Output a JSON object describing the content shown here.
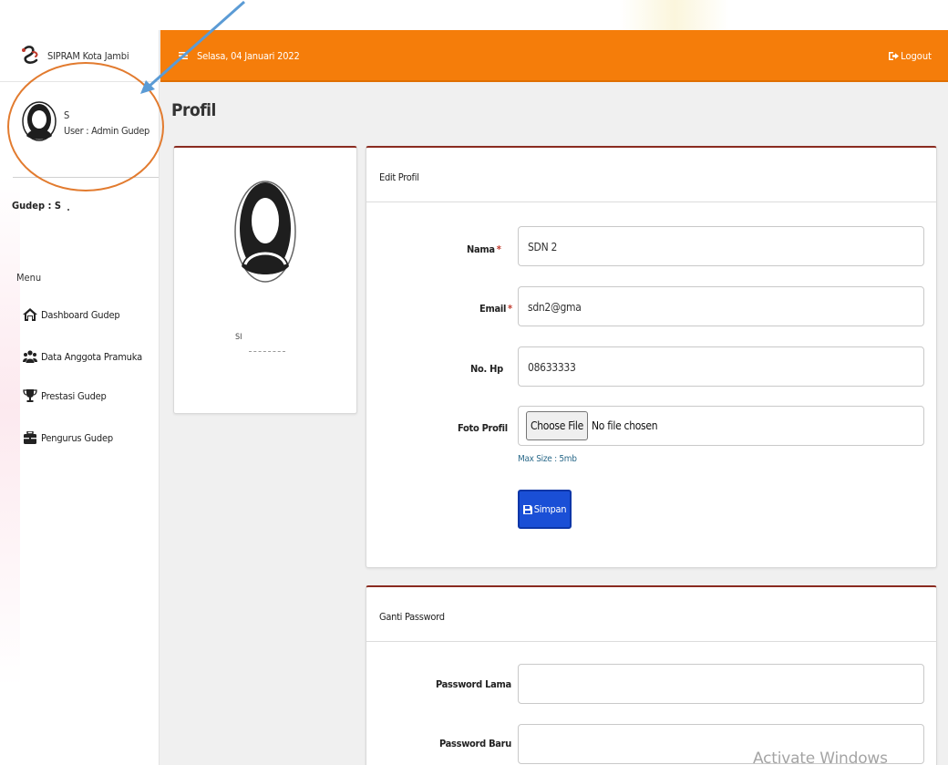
{
  "app": {
    "brand": "SIPRAM Kota Jambi",
    "date": "Selasa, 04 Januari 2022",
    "logout": "Logout"
  },
  "user": {
    "name": "S",
    "role": "User : Admin Gudep"
  },
  "sidebar": {
    "gudep": "Gudep : S",
    "menu_title": "Menu",
    "items": [
      {
        "label": "Dashboard Gudep",
        "icon": "home-icon"
      },
      {
        "label": "Data Anggota Pramuka",
        "icon": "users-icon"
      },
      {
        "label": "Prestasi Gudep",
        "icon": "trophy-icon"
      },
      {
        "label": "Pengurus Gudep",
        "icon": "briefcase-icon"
      }
    ]
  },
  "page": {
    "title": "Profil"
  },
  "profile_card": {
    "name": "SI"
  },
  "edit_profile": {
    "title": "Edit Profil",
    "nama_label": "Nama",
    "nama_value": "SDN 2",
    "email_label": "Email",
    "email_value": "sdn2@gma",
    "hp_label": "No. Hp",
    "hp_value": "08633333",
    "foto_label": "Foto Profil",
    "file_button": "Choose File",
    "file_status": "No file chosen",
    "max_size": "Max Size : 5mb",
    "save_label": "Simpan",
    "required_mark": "*"
  },
  "change_password": {
    "title": "Ganti Password",
    "old_label": "Password Lama",
    "new_label": "Password Baru"
  },
  "overlay": {
    "watermark": "Activate Windows"
  },
  "colors": {
    "header": "#f57d0a",
    "card_top_border": "#8a2b20",
    "save_button": "#1a4fd6",
    "annotation_ring": "#e27b2f",
    "annotation_arrow": "#5b9bd5"
  }
}
